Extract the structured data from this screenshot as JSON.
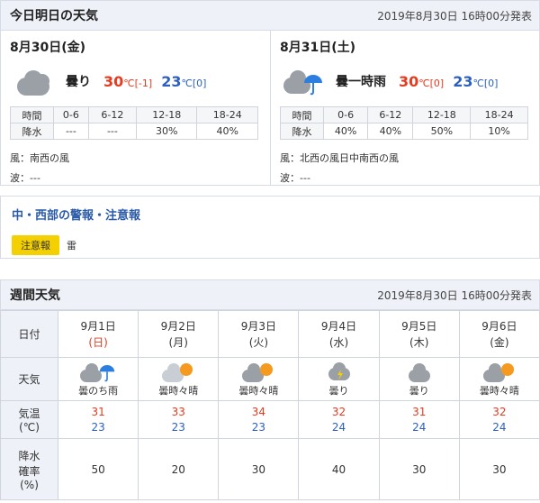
{
  "today_tomorrow": {
    "title": "今日明日の天気",
    "issued": "2019年8月30日 16時00分発表",
    "days": [
      {
        "date": "8月30日(金)",
        "weather": "曇り",
        "icon": "cloudy-icon",
        "max": "30",
        "max_diff": "[-1]",
        "min": "23",
        "min_diff": "[0]",
        "unit": "℃",
        "pop_time_label": "時間",
        "pop_label": "降水",
        "pop_times": [
          "0-6",
          "6-12",
          "12-18",
          "18-24"
        ],
        "pop_values": [
          "---",
          "---",
          "30%",
          "40%"
        ],
        "wind": "風：南西の風",
        "wave": "波：---"
      },
      {
        "date": "8月31日(土)",
        "weather": "曇一時雨",
        "icon": "cloudy-rain-icon",
        "max": "30",
        "max_diff": "[0]",
        "min": "23",
        "min_diff": "[0]",
        "unit": "℃",
        "pop_time_label": "時間",
        "pop_label": "降水",
        "pop_times": [
          "0-6",
          "6-12",
          "12-18",
          "18-24"
        ],
        "pop_values": [
          "40%",
          "40%",
          "50%",
          "10%"
        ],
        "wind": "風：北西の風日中南西の風",
        "wave": "波：---"
      }
    ]
  },
  "warnings": {
    "title": "中・西部の警報・注意報",
    "badge": "注意報",
    "item": "雷"
  },
  "weekly": {
    "title": "週間天気",
    "issued": "2019年8月30日 16時00分発表",
    "labels": {
      "date": "日付",
      "weather": "天気",
      "temp_line1": "気温",
      "temp_line2": "(℃)",
      "pop_line1": "降水",
      "pop_line2": "確率",
      "pop_line3": "(%)"
    },
    "days": [
      {
        "date": "9月1日",
        "dow": "(日)",
        "dow_type": "sun",
        "weather": "曇のち雨",
        "icon": "cloud-then-rain-icon",
        "max": "31",
        "min": "23",
        "pop": "50"
      },
      {
        "date": "9月2日",
        "dow": "(月)",
        "dow_type": "",
        "weather": "曇時々晴",
        "icon": "cloud-sometimes-sun-icon",
        "max": "33",
        "min": "23",
        "pop": "20"
      },
      {
        "date": "9月3日",
        "dow": "(火)",
        "dow_type": "",
        "weather": "曇時々晴",
        "icon": "cloud-sometimes-sun-icon",
        "max": "34",
        "min": "23",
        "pop": "30"
      },
      {
        "date": "9月4日",
        "dow": "(水)",
        "dow_type": "",
        "weather": "曇り",
        "icon": "cloud-thunder-icon",
        "max": "32",
        "min": "24",
        "pop": "40"
      },
      {
        "date": "9月5日",
        "dow": "(木)",
        "dow_type": "",
        "weather": "曇り",
        "icon": "cloudy-icon",
        "max": "31",
        "min": "24",
        "pop": "30"
      },
      {
        "date": "9月6日",
        "dow": "(金)",
        "dow_type": "",
        "weather": "曇時々晴",
        "icon": "cloud-sometimes-sun-icon",
        "max": "32",
        "min": "24",
        "pop": "30"
      }
    ]
  }
}
